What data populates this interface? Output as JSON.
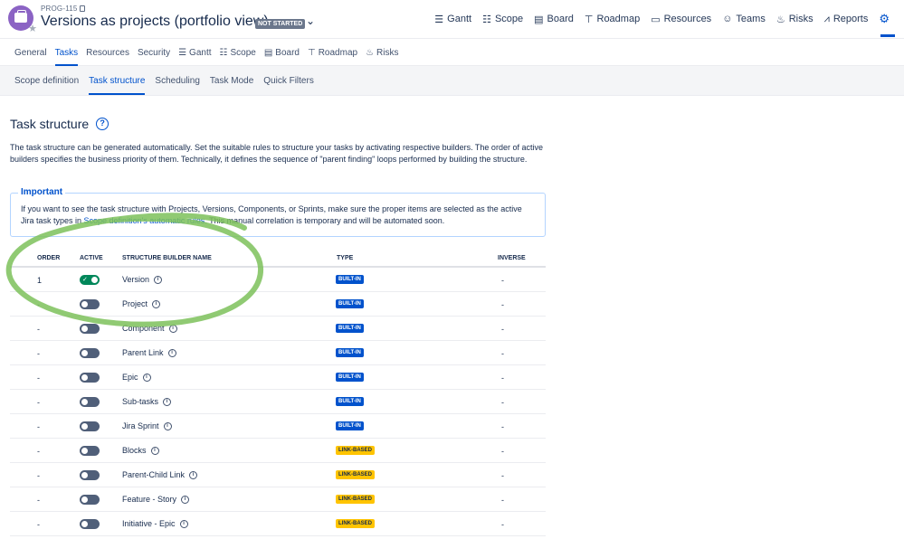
{
  "header": {
    "project_key": "PROG-115",
    "project_title": "Versions as projects (portfolio view)",
    "status": "NOT STARTED",
    "nav": [
      {
        "label": "Gantt",
        "icon": "gantt-icon",
        "glyph": "☰"
      },
      {
        "label": "Scope",
        "icon": "scope-icon",
        "glyph": "☷"
      },
      {
        "label": "Board",
        "icon": "board-icon",
        "glyph": "▤"
      },
      {
        "label": "Roadmap",
        "icon": "roadmap-icon",
        "glyph": "⊤"
      },
      {
        "label": "Resources",
        "icon": "resources-icon",
        "glyph": "▭"
      },
      {
        "label": "Teams",
        "icon": "teams-icon",
        "glyph": "☺"
      },
      {
        "label": "Risks",
        "icon": "risks-icon",
        "glyph": "♨"
      },
      {
        "label": "Reports",
        "icon": "reports-icon",
        "glyph": "⩘"
      }
    ]
  },
  "tabs": [
    {
      "label": "General",
      "glyph": ""
    },
    {
      "label": "Tasks",
      "glyph": "",
      "active": true
    },
    {
      "label": "Resources",
      "glyph": ""
    },
    {
      "label": "Security",
      "glyph": ""
    },
    {
      "label": "Gantt",
      "glyph": "☰"
    },
    {
      "label": "Scope",
      "glyph": "☷"
    },
    {
      "label": "Board",
      "glyph": "▤"
    },
    {
      "label": "Roadmap",
      "glyph": "⊤"
    },
    {
      "label": "Risks",
      "glyph": "♨"
    }
  ],
  "subtabs": [
    {
      "label": "Scope definition"
    },
    {
      "label": "Task structure",
      "active": true
    },
    {
      "label": "Scheduling"
    },
    {
      "label": "Task Mode"
    },
    {
      "label": "Quick Filters"
    }
  ],
  "page": {
    "title": "Task structure",
    "description": "The task structure can be generated automatically. Set the suitable rules to structure your tasks by activating respective builders. The order of active builders specifies the business priority of them. Technically, it defines the sequence of \"parent finding\" loops performed by building the structure.",
    "important_label": "Important",
    "important_text_1": "If you want to see the task structure with Projects, Versions, Components, or Sprints, make sure the proper items are selected as the active Jira task types in ",
    "important_link": "Scope definition's automatic rules.",
    "important_text_2": " This manual correlation is temporary and will be automated soon."
  },
  "table": {
    "columns": {
      "order": "ORDER",
      "active": "ACTIVE",
      "name": "STRUCTURE BUILDER NAME",
      "type": "TYPE",
      "inverse": "INVERSE"
    },
    "rows": [
      {
        "order": "1",
        "active": true,
        "name": "Version",
        "type": "BUILT-IN",
        "inverse": "-"
      },
      {
        "order": "-",
        "active": false,
        "name": "Project",
        "type": "BUILT-IN",
        "inverse": "-"
      },
      {
        "order": "-",
        "active": false,
        "name": "Component",
        "type": "BUILT-IN",
        "inverse": "-"
      },
      {
        "order": "-",
        "active": false,
        "name": "Parent Link",
        "type": "BUILT-IN",
        "inverse": "-"
      },
      {
        "order": "-",
        "active": false,
        "name": "Epic",
        "type": "BUILT-IN",
        "inverse": "-"
      },
      {
        "order": "-",
        "active": false,
        "name": "Sub-tasks",
        "type": "BUILT-IN",
        "inverse": "-"
      },
      {
        "order": "-",
        "active": false,
        "name": "Jira Sprint",
        "type": "BUILT-IN",
        "inverse": "-"
      },
      {
        "order": "-",
        "active": false,
        "name": "Blocks",
        "type": "LINK-BASED",
        "inverse": "-"
      },
      {
        "order": "-",
        "active": false,
        "name": "Parent-Child Link",
        "type": "LINK-BASED",
        "inverse": "-"
      },
      {
        "order": "-",
        "active": false,
        "name": "Feature - Story",
        "type": "LINK-BASED",
        "inverse": "-"
      },
      {
        "order": "-",
        "active": false,
        "name": "Initiative - Epic",
        "type": "LINK-BASED",
        "inverse": "-"
      }
    ]
  },
  "colors": {
    "accent": "#0052cc",
    "toggle_on": "#00875a",
    "builtin": "#0052cc",
    "link_based": "#ffc400",
    "annotation": "#7cc15a"
  }
}
